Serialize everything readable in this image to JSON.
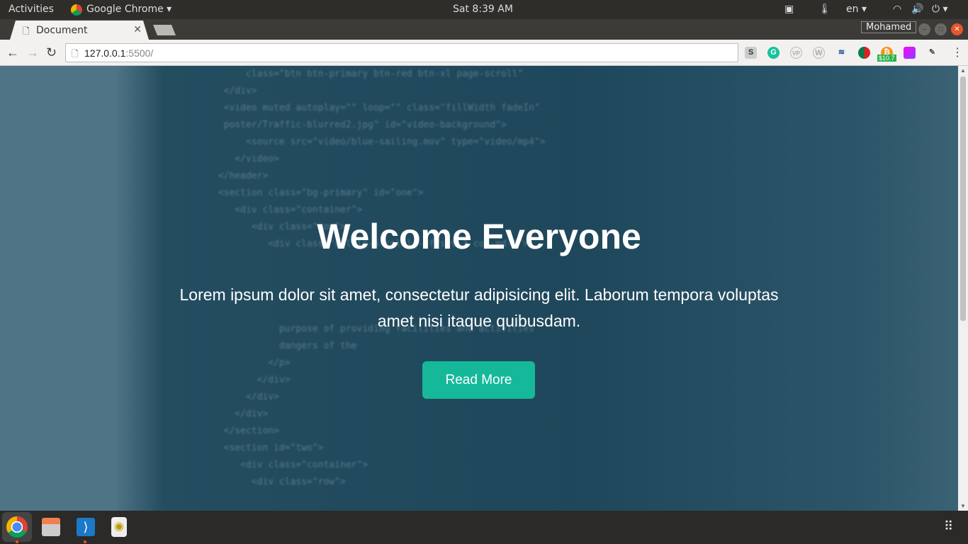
{
  "system": {
    "activities": "Activities",
    "app": "Google Chrome",
    "clock": "Sat  8:39 AM",
    "lang": "en"
  },
  "browser": {
    "tab_title": "Document",
    "user": "Mohamed",
    "url_host": "127.0.0.1",
    "url_port": ":5500/",
    "bitcoin_badge": "$10.7",
    "extensions": [
      "s-icon",
      "grammarly-icon",
      "vp-icon",
      "wordpress-icon",
      "steem-icon",
      "extension-icon",
      "bitcoin-icon",
      "gradient-icon",
      "eyedropper-icon"
    ]
  },
  "hero": {
    "title": "Welcome Everyone",
    "text": "Lorem ipsum dolor sit amet, consectetur adipisicing elit. Laborum tempora voluptas amet nisi itaque quibusdam.",
    "button": "Read More",
    "accent": "#16b89a"
  },
  "dock": [
    "chrome-icon",
    "files-icon",
    "vscode-icon",
    "rhythmbox-icon"
  ]
}
